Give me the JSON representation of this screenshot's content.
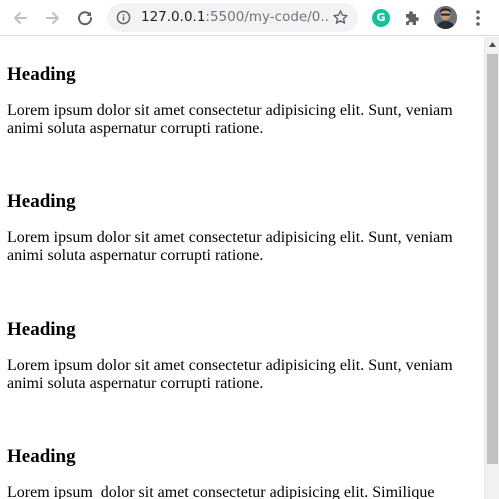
{
  "browser": {
    "url_host": "127.0.0.1",
    "url_rest": ":5500/my-code/0...",
    "icons": {
      "back": "arrow-left-icon",
      "forward": "arrow-right-icon",
      "reload": "reload-icon",
      "site_info": "info-icon",
      "bookmark": "star-icon",
      "grammarly": "grammarly-icon",
      "extensions": "puzzle-icon",
      "profile": "avatar",
      "menu": "kebab-menu-icon"
    },
    "grammarly_letter": "G",
    "colors": {
      "grammarly": "#15c39a",
      "disabled_icon": "#bdc1c6",
      "icon": "#5f6368"
    }
  },
  "page": {
    "sections": [
      {
        "heading": "Heading",
        "text": "Lorem ipsum dolor sit amet consectetur adipisicing elit. Sunt, veniam animi soluta aspernatur corrupti ratione."
      },
      {
        "heading": "Heading",
        "text": "Lorem ipsum dolor sit amet consectetur adipisicing elit. Sunt, veniam animi soluta aspernatur corrupti ratione."
      },
      {
        "heading": "Heading",
        "text": "Lorem ipsum dolor sit amet consectetur adipisicing elit. Sunt, veniam animi soluta aspernatur corrupti ratione."
      },
      {
        "heading": "Heading",
        "text": "Lorem ipsum  dolor sit amet consectetur adipisicing elit. Similique"
      }
    ]
  }
}
